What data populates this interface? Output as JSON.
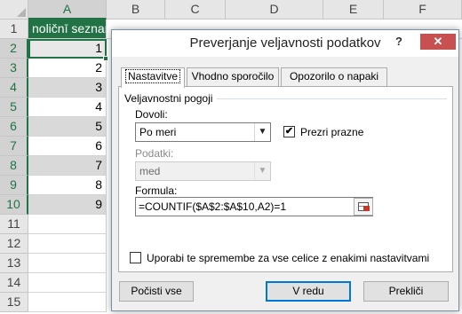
{
  "spreadsheet": {
    "columns": [
      "A",
      "B",
      "C",
      "D",
      "E",
      "F"
    ],
    "rows": [
      "1",
      "2",
      "3",
      "4",
      "5",
      "6",
      "7",
      "8",
      "9",
      "10",
      "11",
      "12",
      "13",
      "14",
      "15"
    ],
    "a1_text": "noličnī seznam",
    "values": [
      "1",
      "2",
      "3",
      "4",
      "5",
      "6",
      "7",
      "8",
      "9"
    ],
    "colors": {
      "header_green": "#217346",
      "gray_fill": "#d9d9d9"
    }
  },
  "dialog": {
    "title": "Preverjanje veljavnosti podatkov",
    "help_label": "?",
    "close_label": "✕",
    "tabs": [
      {
        "label": "Nastavitve"
      },
      {
        "label": "Vhodno sporočilo"
      },
      {
        "label": "Opozorilo o napaki"
      }
    ],
    "group_title": "Veljavnostni pogoji",
    "allow_label": "Dovoli:",
    "allow_value": "Po meri",
    "ignore_blank_label": "Prezri prazne",
    "ignore_blank_mark": "✔",
    "data_label": "Podatki:",
    "data_value": "med",
    "formula_label": "Formula:",
    "formula_value": "=COUNTIF($A$2:$A$10,A2)=1",
    "apply_all_label": "Uporabi te spremembe za vse celice z enakimi nastavitvami",
    "buttons": {
      "clear": "Počisti vse",
      "ok": "V redu",
      "cancel": "Prekliči"
    },
    "icons": {
      "dropdown": "chevron-down-icon",
      "ref": "range-select-icon",
      "check": "checkmark-icon",
      "close": "close-icon"
    }
  }
}
